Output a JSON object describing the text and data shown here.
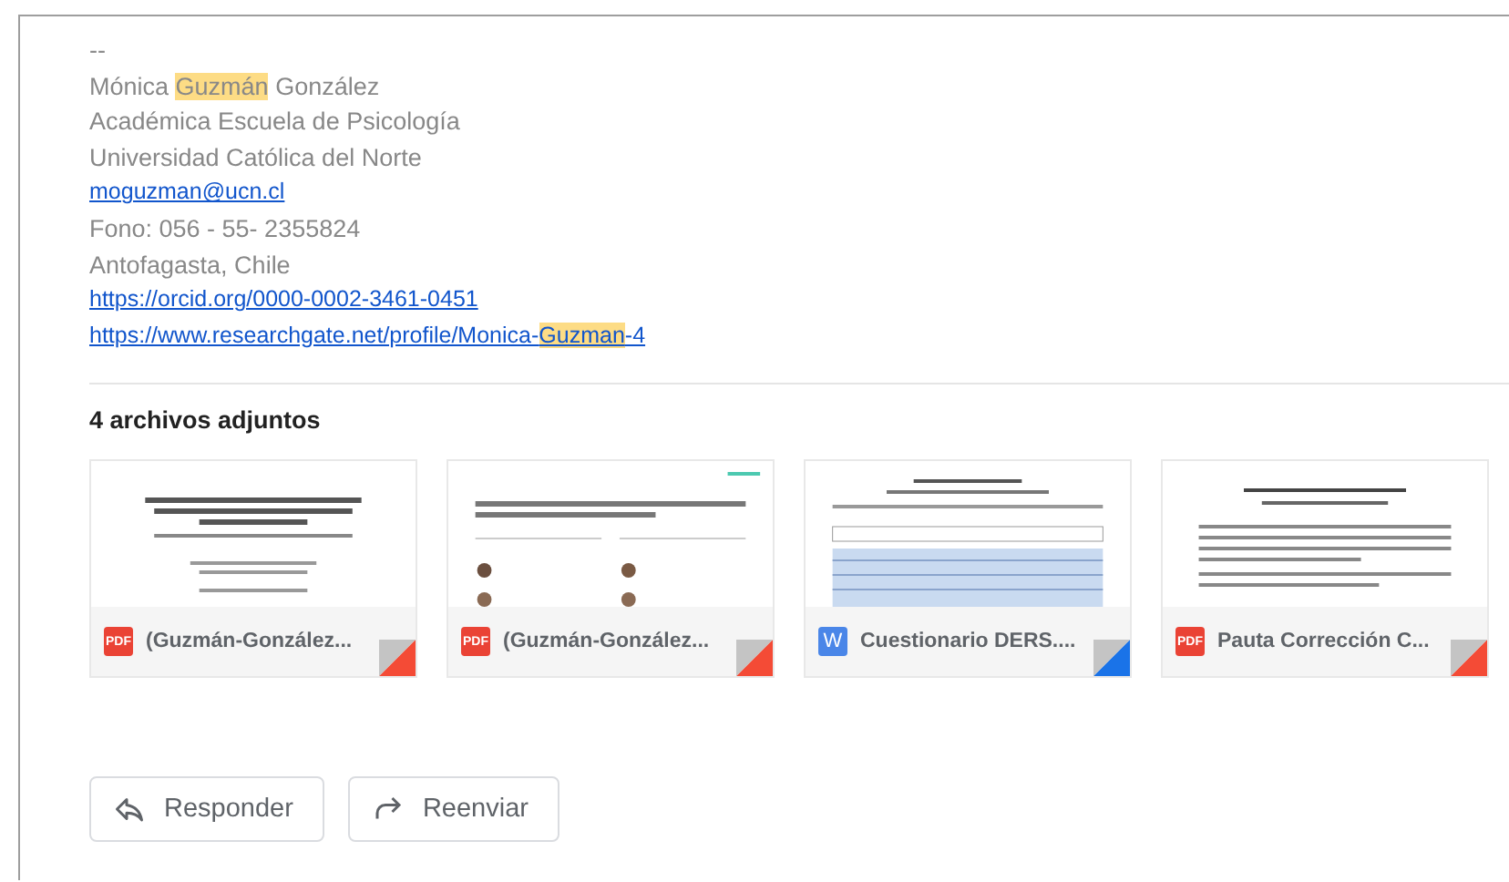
{
  "signature": [
    {
      "kind": "text",
      "parts": [
        {
          "text": "--",
          "highlighted": false
        }
      ]
    },
    {
      "kind": "text",
      "parts": [
        {
          "text": "Mónica ",
          "highlighted": false
        },
        {
          "text": "Guzmán",
          "highlighted": true
        },
        {
          "text": " González",
          "highlighted": false
        }
      ]
    },
    {
      "kind": "text",
      "parts": [
        {
          "text": "Académica Escuela de Psicología",
          "highlighted": false
        }
      ]
    },
    {
      "kind": "text",
      "parts": [
        {
          "text": "Universidad Católica del Norte",
          "highlighted": false
        }
      ]
    },
    {
      "kind": "link",
      "parts": [
        {
          "text": "moguzman@ucn.cl",
          "highlighted": false
        }
      ]
    },
    {
      "kind": "text",
      "parts": [
        {
          "text": "Fono: 056 - 55- 2355824",
          "highlighted": false
        }
      ]
    },
    {
      "kind": "text",
      "parts": [
        {
          "text": "Antofagasta, Chile",
          "highlighted": false
        }
      ]
    },
    {
      "kind": "link",
      "parts": [
        {
          "text": "https://orcid.org/0000-0002-3461-0451",
          "highlighted": false
        }
      ]
    },
    {
      "kind": "link",
      "parts": [
        {
          "text": "https://www.researchgate.net/profile/Monica-",
          "highlighted": false
        },
        {
          "text": "Guzman",
          "highlighted": true
        },
        {
          "text": "-4",
          "highlighted": false
        }
      ]
    }
  ],
  "attachments": {
    "heading": "4 archivos adjuntos",
    "items": [
      {
        "kind": "pdf",
        "badge": "PDF",
        "name": "(Guzmán-González..."
      },
      {
        "kind": "pdf",
        "badge": "PDF",
        "name": "(Guzmán-González..."
      },
      {
        "kind": "word",
        "badge": "W",
        "name": "Cuestionario DERS...."
      },
      {
        "kind": "pdf",
        "badge": "PDF",
        "name": "Pauta Corrección C..."
      }
    ]
  },
  "buttons": [
    {
      "kind": "reply",
      "label": "Responder"
    },
    {
      "kind": "forward",
      "label": "Reenviar"
    }
  ]
}
